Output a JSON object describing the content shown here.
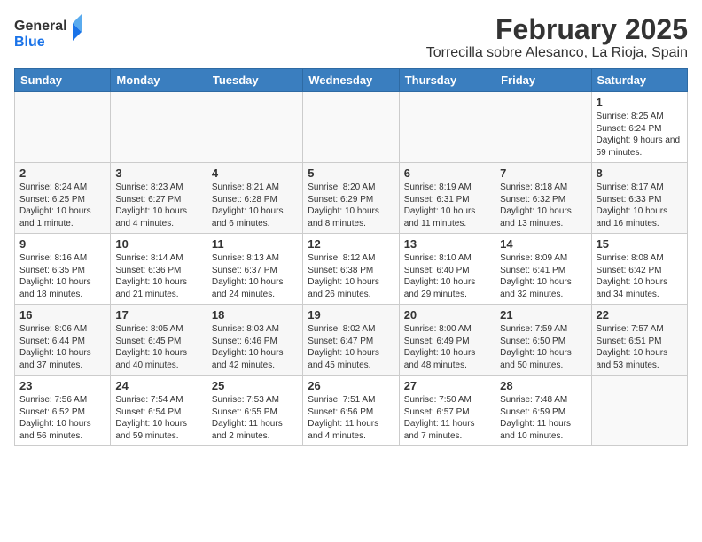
{
  "logo": {
    "line1": "General",
    "line2": "Blue"
  },
  "title": "February 2025",
  "location": "Torrecilla sobre Alesanco, La Rioja, Spain",
  "weekdays": [
    "Sunday",
    "Monday",
    "Tuesday",
    "Wednesday",
    "Thursday",
    "Friday",
    "Saturday"
  ],
  "weeks": [
    [
      {
        "day": "",
        "info": ""
      },
      {
        "day": "",
        "info": ""
      },
      {
        "day": "",
        "info": ""
      },
      {
        "day": "",
        "info": ""
      },
      {
        "day": "",
        "info": ""
      },
      {
        "day": "",
        "info": ""
      },
      {
        "day": "1",
        "info": "Sunrise: 8:25 AM\nSunset: 6:24 PM\nDaylight: 9 hours and 59 minutes."
      }
    ],
    [
      {
        "day": "2",
        "info": "Sunrise: 8:24 AM\nSunset: 6:25 PM\nDaylight: 10 hours and 1 minute."
      },
      {
        "day": "3",
        "info": "Sunrise: 8:23 AM\nSunset: 6:27 PM\nDaylight: 10 hours and 4 minutes."
      },
      {
        "day": "4",
        "info": "Sunrise: 8:21 AM\nSunset: 6:28 PM\nDaylight: 10 hours and 6 minutes."
      },
      {
        "day": "5",
        "info": "Sunrise: 8:20 AM\nSunset: 6:29 PM\nDaylight: 10 hours and 8 minutes."
      },
      {
        "day": "6",
        "info": "Sunrise: 8:19 AM\nSunset: 6:31 PM\nDaylight: 10 hours and 11 minutes."
      },
      {
        "day": "7",
        "info": "Sunrise: 8:18 AM\nSunset: 6:32 PM\nDaylight: 10 hours and 13 minutes."
      },
      {
        "day": "8",
        "info": "Sunrise: 8:17 AM\nSunset: 6:33 PM\nDaylight: 10 hours and 16 minutes."
      }
    ],
    [
      {
        "day": "9",
        "info": "Sunrise: 8:16 AM\nSunset: 6:35 PM\nDaylight: 10 hours and 18 minutes."
      },
      {
        "day": "10",
        "info": "Sunrise: 8:14 AM\nSunset: 6:36 PM\nDaylight: 10 hours and 21 minutes."
      },
      {
        "day": "11",
        "info": "Sunrise: 8:13 AM\nSunset: 6:37 PM\nDaylight: 10 hours and 24 minutes."
      },
      {
        "day": "12",
        "info": "Sunrise: 8:12 AM\nSunset: 6:38 PM\nDaylight: 10 hours and 26 minutes."
      },
      {
        "day": "13",
        "info": "Sunrise: 8:10 AM\nSunset: 6:40 PM\nDaylight: 10 hours and 29 minutes."
      },
      {
        "day": "14",
        "info": "Sunrise: 8:09 AM\nSunset: 6:41 PM\nDaylight: 10 hours and 32 minutes."
      },
      {
        "day": "15",
        "info": "Sunrise: 8:08 AM\nSunset: 6:42 PM\nDaylight: 10 hours and 34 minutes."
      }
    ],
    [
      {
        "day": "16",
        "info": "Sunrise: 8:06 AM\nSunset: 6:44 PM\nDaylight: 10 hours and 37 minutes."
      },
      {
        "day": "17",
        "info": "Sunrise: 8:05 AM\nSunset: 6:45 PM\nDaylight: 10 hours and 40 minutes."
      },
      {
        "day": "18",
        "info": "Sunrise: 8:03 AM\nSunset: 6:46 PM\nDaylight: 10 hours and 42 minutes."
      },
      {
        "day": "19",
        "info": "Sunrise: 8:02 AM\nSunset: 6:47 PM\nDaylight: 10 hours and 45 minutes."
      },
      {
        "day": "20",
        "info": "Sunrise: 8:00 AM\nSunset: 6:49 PM\nDaylight: 10 hours and 48 minutes."
      },
      {
        "day": "21",
        "info": "Sunrise: 7:59 AM\nSunset: 6:50 PM\nDaylight: 10 hours and 50 minutes."
      },
      {
        "day": "22",
        "info": "Sunrise: 7:57 AM\nSunset: 6:51 PM\nDaylight: 10 hours and 53 minutes."
      }
    ],
    [
      {
        "day": "23",
        "info": "Sunrise: 7:56 AM\nSunset: 6:52 PM\nDaylight: 10 hours and 56 minutes."
      },
      {
        "day": "24",
        "info": "Sunrise: 7:54 AM\nSunset: 6:54 PM\nDaylight: 10 hours and 59 minutes."
      },
      {
        "day": "25",
        "info": "Sunrise: 7:53 AM\nSunset: 6:55 PM\nDaylight: 11 hours and 2 minutes."
      },
      {
        "day": "26",
        "info": "Sunrise: 7:51 AM\nSunset: 6:56 PM\nDaylight: 11 hours and 4 minutes."
      },
      {
        "day": "27",
        "info": "Sunrise: 7:50 AM\nSunset: 6:57 PM\nDaylight: 11 hours and 7 minutes."
      },
      {
        "day": "28",
        "info": "Sunrise: 7:48 AM\nSunset: 6:59 PM\nDaylight: 11 hours and 10 minutes."
      },
      {
        "day": "",
        "info": ""
      }
    ]
  ]
}
